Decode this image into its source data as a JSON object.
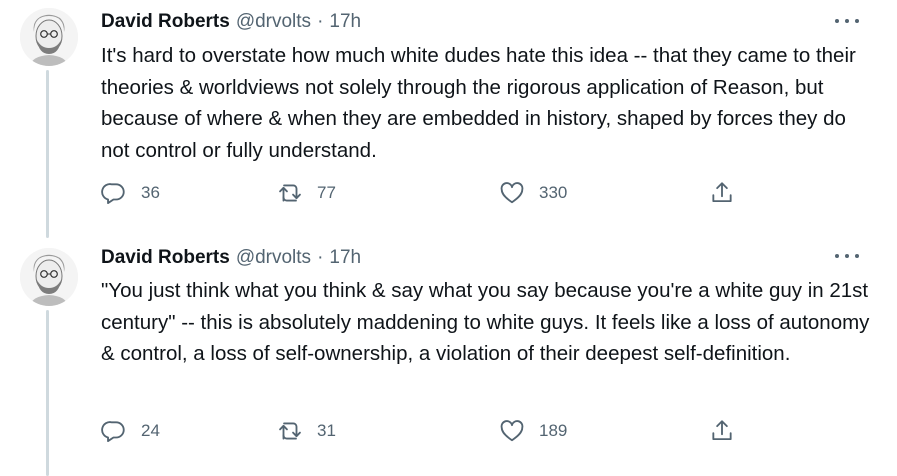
{
  "tweets": [
    {
      "name": "David Roberts",
      "handle": "@drvolts",
      "separator": "·",
      "time": "17h",
      "text": "It's hard to overstate how much white dudes hate this idea -- that they came to their theories & worldviews not solely through the rigorous application of Reason, but because of where & when they are embedded in history, shaped by forces they do not control or fully understand.",
      "replies": "36",
      "retweets": "77",
      "likes": "330"
    },
    {
      "name": "David Roberts",
      "handle": "@drvolts",
      "separator": "·",
      "time": "17h",
      "text": "\"You just think what you think & say what you say because you're a white guy in 21st century\" -- this is absolutely maddening to white guys. It feels like a loss of autonomy & control, a loss of self-ownership, a violation of their deepest self-definition.",
      "replies": "24",
      "retweets": "31",
      "likes": "189"
    }
  ],
  "icons": {
    "reply": "reply-icon",
    "retweet": "retweet-icon",
    "like": "heart-icon",
    "share": "share-icon",
    "more": "more-options-icon"
  },
  "colors": {
    "text": "#0f1419",
    "secondary": "#536471",
    "thread_line": "#cfd9de"
  }
}
